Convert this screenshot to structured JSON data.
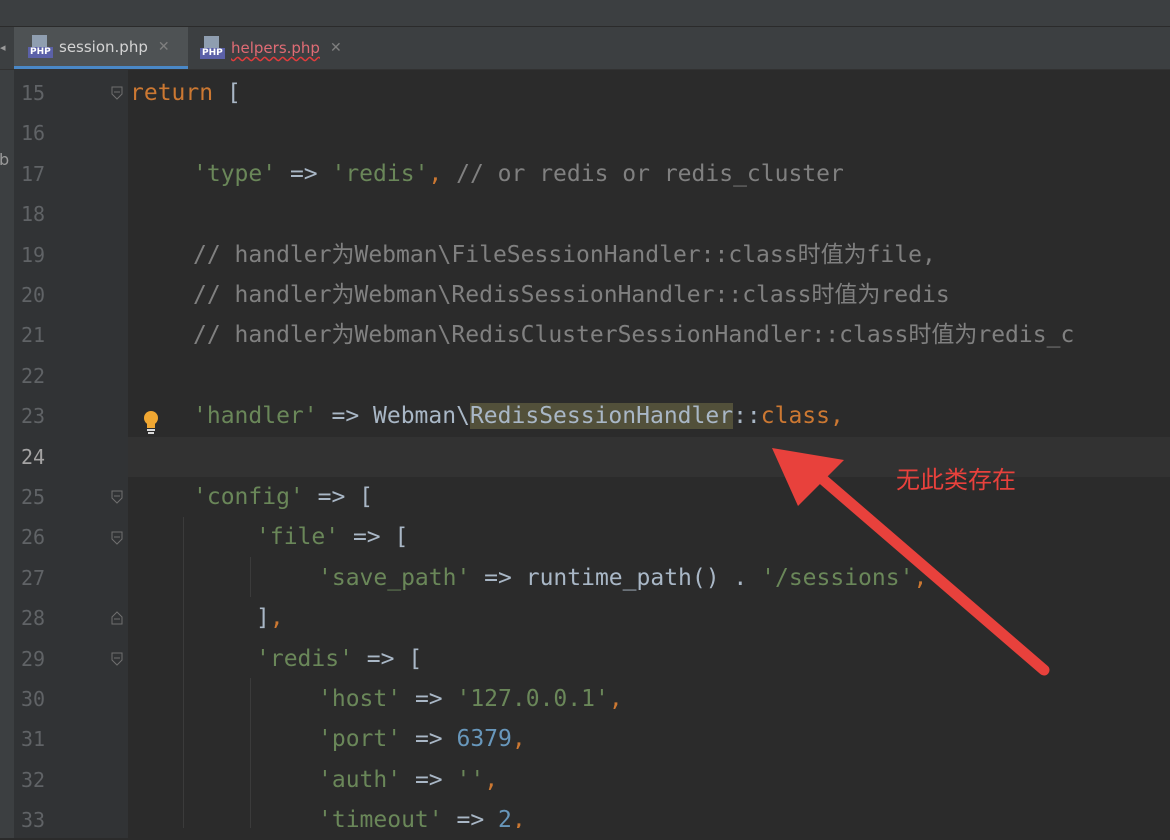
{
  "tabs": [
    {
      "label": "session.php",
      "active": true,
      "error": false
    },
    {
      "label": "helpers.php",
      "active": false,
      "error": true
    }
  ],
  "project_letter": "b",
  "annotation": "无此类存在",
  "current_line": "24",
  "lines": [
    {
      "n": "15"
    },
    {
      "n": "16"
    },
    {
      "n": "17"
    },
    {
      "n": "18"
    },
    {
      "n": "19"
    },
    {
      "n": "20"
    },
    {
      "n": "21"
    },
    {
      "n": "22"
    },
    {
      "n": "23"
    },
    {
      "n": "24"
    },
    {
      "n": "25"
    },
    {
      "n": "26"
    },
    {
      "n": "27"
    },
    {
      "n": "28"
    },
    {
      "n": "29"
    },
    {
      "n": "30"
    },
    {
      "n": "31"
    },
    {
      "n": "32"
    },
    {
      "n": "33"
    }
  ],
  "code": {
    "l15": {
      "kw": "return",
      "rest": " ["
    },
    "l17": {
      "key": "'type'",
      "op": " => ",
      "val": "'redis'",
      "comma": ",",
      "comment": " // or redis or redis_cluster"
    },
    "l19": "// handler为Webman\\FileSessionHandler::class时值为file,",
    "l20": "// handler为Webman\\RedisSessionHandler::class时值为redis",
    "l21": "// handler为Webman\\RedisClusterSessionHandler::class时值为redis_c",
    "l23": {
      "key": "'handler'",
      "op": " => Webman\\",
      "cls": "RedisSessionHandler",
      "sep": "::",
      "kw": "class",
      "comma": ","
    },
    "l25": {
      "key": "'config'",
      "op": " => ["
    },
    "l26": {
      "key": "'file'",
      "op": " => ["
    },
    "l27": {
      "key": "'save_path'",
      "op": " => runtime_path() . ",
      "val": "'/sessions'",
      "comma": ","
    },
    "l28": {
      "close": "]",
      "comma": ","
    },
    "l29": {
      "key": "'redis'",
      "op": " => ["
    },
    "l30": {
      "key": "'host'",
      "op": " => ",
      "val": "'127.0.0.1'",
      "comma": ","
    },
    "l31": {
      "key": "'port'",
      "op": " => ",
      "num": "6379",
      "comma": ","
    },
    "l32": {
      "key": "'auth'",
      "op": " => ",
      "val": "''",
      "comma": ","
    },
    "l33": {
      "key": "'timeout'",
      "op": " => ",
      "num": "2",
      "comma": ","
    }
  },
  "colors": {
    "keyword": "#cc7832",
    "string": "#6a8759",
    "comment": "#808080",
    "number": "#6897bb",
    "text": "#a9b7c6",
    "annotation": "#e8413c"
  }
}
